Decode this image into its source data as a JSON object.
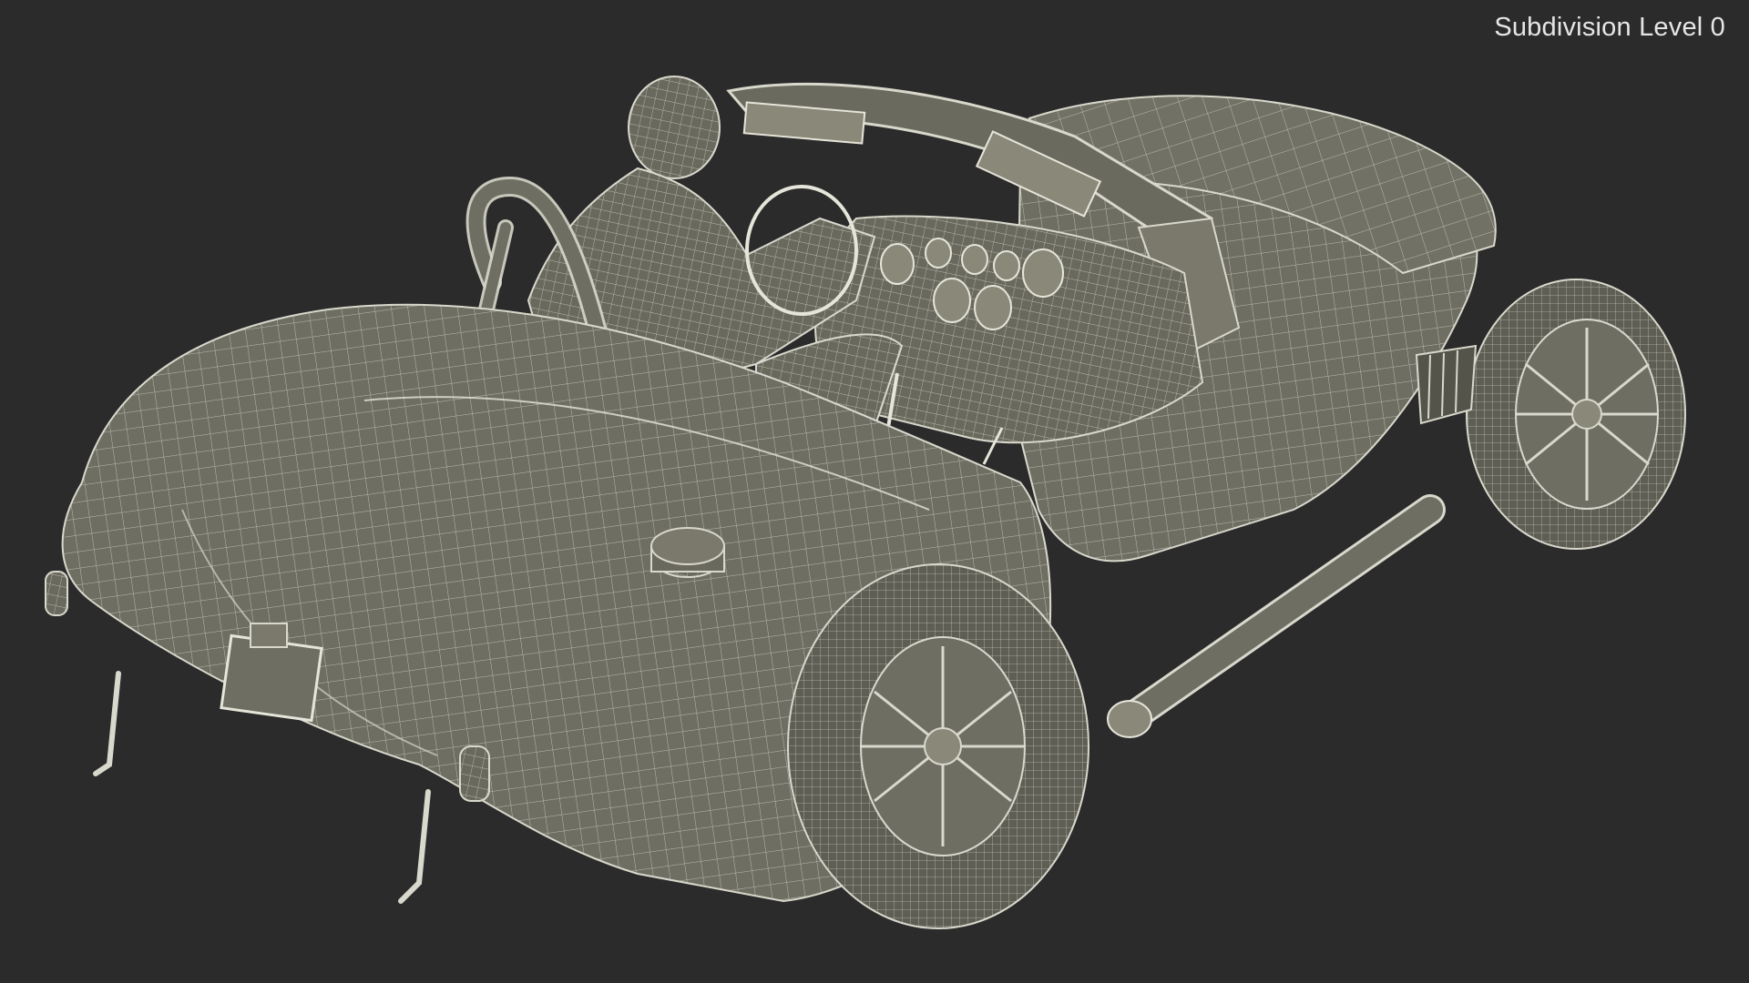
{
  "overlay": {
    "label": "Subdivision Level 0"
  },
  "scene": {
    "subject": "car-with-driver-wireframe",
    "colors": {
      "background": "#2b2b2b",
      "mesh_fill": "#6f6e63",
      "wireframe": "#d9d8cc",
      "label_text": "#e6e6e6"
    }
  }
}
